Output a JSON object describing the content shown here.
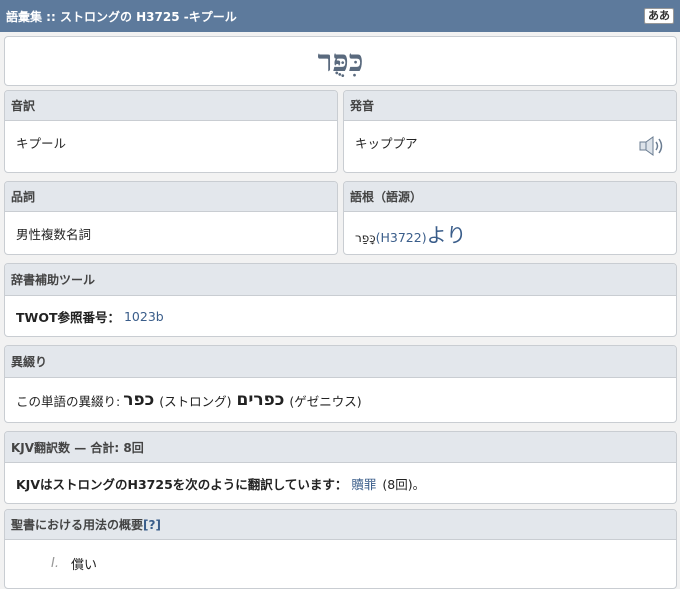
{
  "header": {
    "title": "語彙集 :: ストロングの H3725 -キプール",
    "font_button": "ああ"
  },
  "word": {
    "hebrew": "כִּפֻּר"
  },
  "transliteration": {
    "label": "音訳",
    "value": "キプール"
  },
  "pronunciation": {
    "label": "発音",
    "value": "キッププア",
    "icon": "speaker-icon"
  },
  "part_of_speech": {
    "label": "品詞",
    "value": "男性複数名詞"
  },
  "root": {
    "label": "語根（語源）",
    "hebrew": "כָּפַר",
    "code": "(H3722)",
    "suffix": "より"
  },
  "dictionary_aids": {
    "label": "辞書補助ツール",
    "twot_label": "TWOT参照番号：",
    "twot_value": "1023b"
  },
  "variants": {
    "label": "異綴り",
    "prefix": "この単語の異綴り:",
    "variant1": "כפר",
    "variant1_source": "(ストロング)",
    "variant2": "כפרים",
    "variant2_source": "(ゲゼニウス)"
  },
  "kjv": {
    "label": "KJV翻訳数 — 合計: 8回",
    "text": "KJVはストロングのH3725を次のように翻訳しています：",
    "translation": "贖罪",
    "count": "(8回)。"
  },
  "outline": {
    "label": "聖書における用法の概要",
    "help": "[?]",
    "items": [
      {
        "num": "I.",
        "text": "償い"
      }
    ]
  }
}
